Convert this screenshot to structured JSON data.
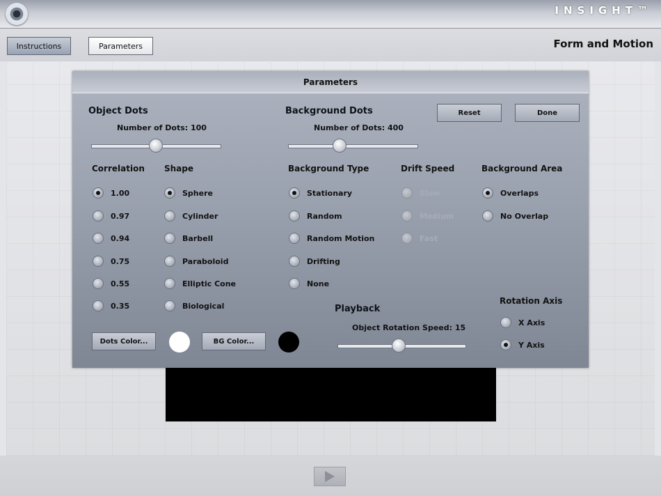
{
  "brand": "INSIGHT™",
  "toolbar": {
    "instructions_label": "Instructions",
    "parameters_label": "Parameters"
  },
  "app_title": "Form and Motion",
  "panel": {
    "title": "Parameters",
    "object_dots": {
      "title": "Object Dots",
      "count_label": "Number of Dots: 100",
      "slider_value": 100
    },
    "background_dots": {
      "title": "Background Dots",
      "count_label": "Number of Dots: 400",
      "slider_value": 400
    },
    "reset_label": "Reset",
    "done_label": "Done",
    "correlation": {
      "title": "Correlation",
      "options": [
        "1.00",
        "0.97",
        "0.94",
        "0.75",
        "0.55",
        "0.35"
      ],
      "selected": "1.00"
    },
    "shape": {
      "title": "Shape",
      "options": [
        "Sphere",
        "Cylinder",
        "Barbell",
        "Paraboloid",
        "Elliptic Cone",
        "Biological"
      ],
      "selected": "Sphere"
    },
    "background_type": {
      "title": "Background Type",
      "options": [
        "Stationary",
        "Random",
        "Random Motion",
        "Drifting",
        "None"
      ],
      "selected": "Stationary"
    },
    "drift_speed": {
      "title": "Drift Speed",
      "options": [
        "Slow",
        "Medium",
        "Fast"
      ],
      "disabled": true
    },
    "background_area": {
      "title": "Background Area",
      "options": [
        "Overlaps",
        "No Overlap"
      ],
      "selected": "Overlaps"
    },
    "playback": {
      "title": "Playback",
      "speed_label": "Object Rotation Speed: 15",
      "slider_value": 15
    },
    "rotation_axis": {
      "title": "Rotation Axis",
      "options": [
        "X Axis",
        "Y Axis"
      ],
      "selected": "Y Axis"
    },
    "dots_color_label": "Dots Color...",
    "bg_color_label": "BG Color...",
    "dots_color": "#ffffff",
    "bg_color": "#000000"
  }
}
